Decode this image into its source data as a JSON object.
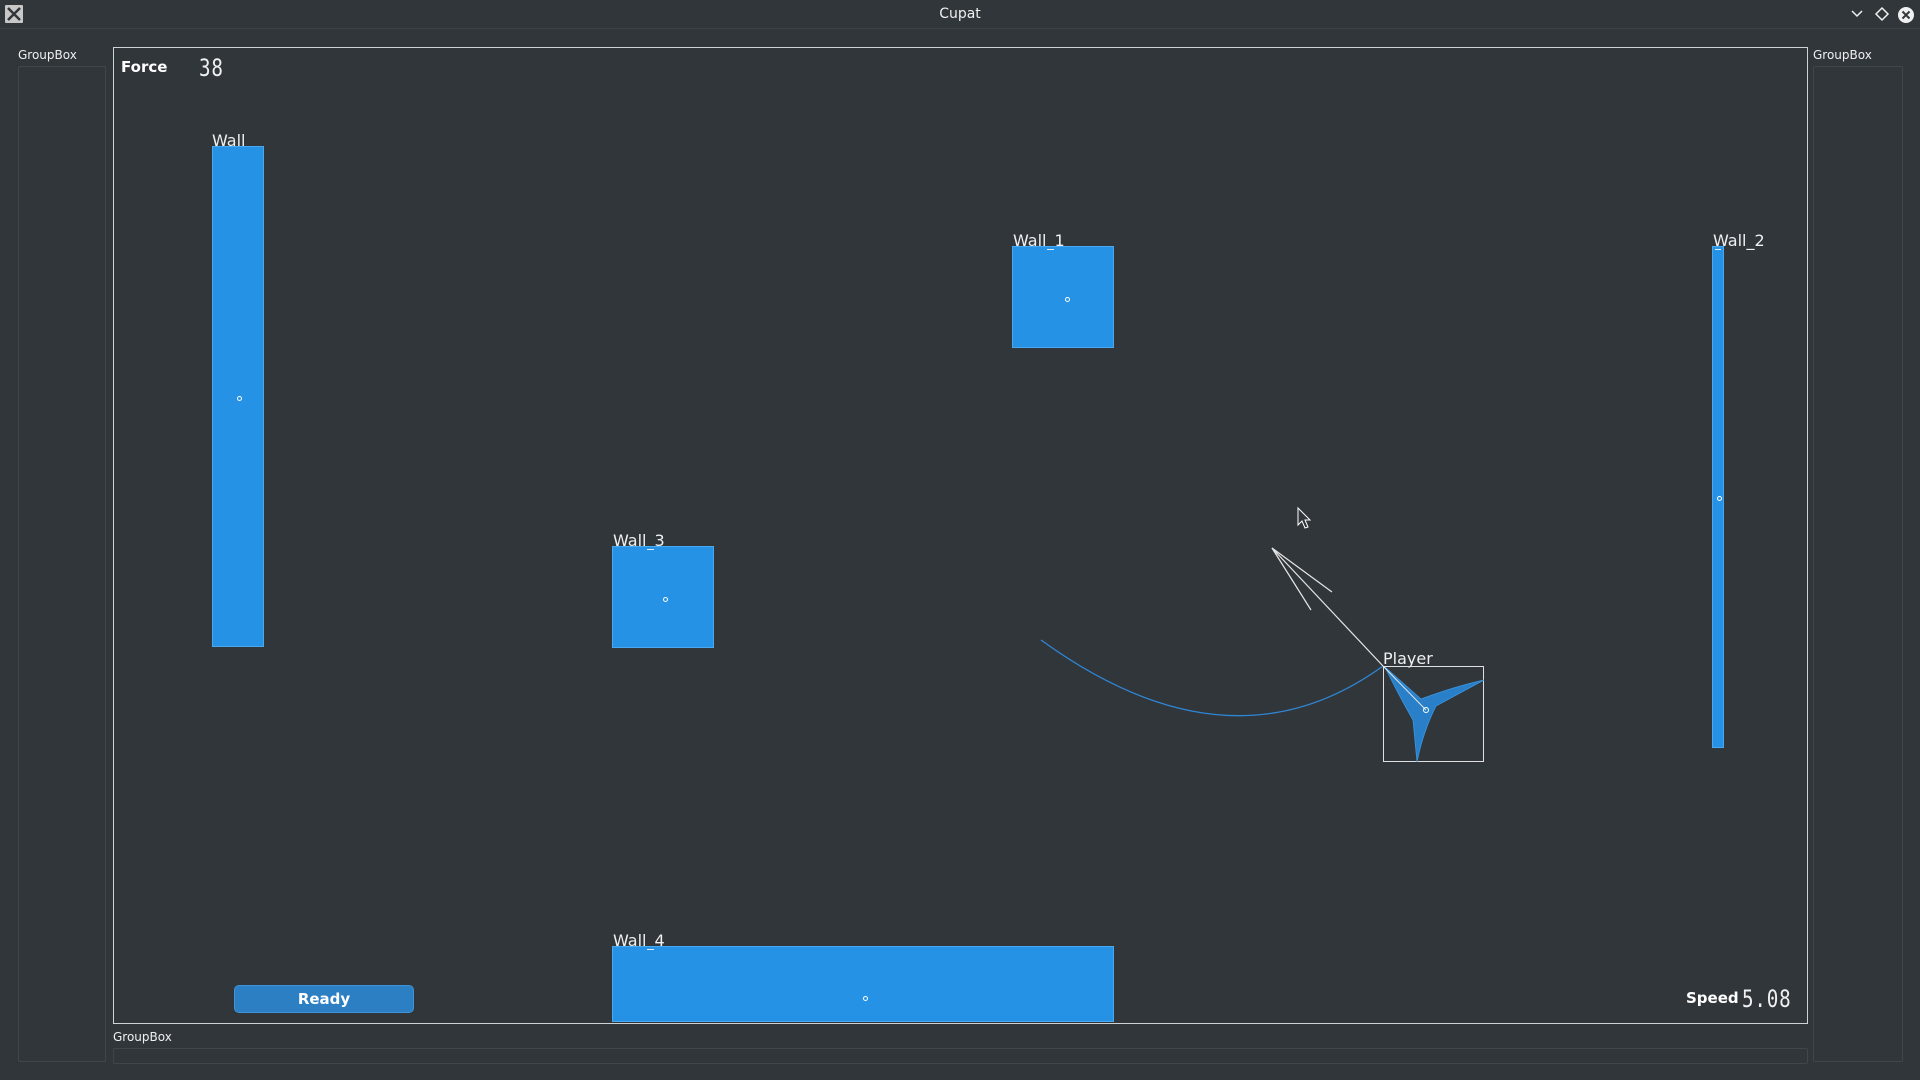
{
  "window": {
    "title": "Cupat"
  },
  "icons": {
    "app": "x-app-icon",
    "minimize": "chevron-down-icon",
    "maximize": "diamond-icon",
    "close": "close-icon",
    "cursor": "mouse-cursor-icon"
  },
  "groupboxes": {
    "left": "GroupBox",
    "right": "GroupBox",
    "bottom": "GroupBox"
  },
  "force": {
    "label": "Force",
    "value": "38"
  },
  "speed": {
    "label": "Speed",
    "value": "5.08"
  },
  "ready_button": {
    "label": "Ready"
  },
  "objects": {
    "wall": "Wall",
    "wall_1": "Wall_1",
    "wall_2": "Wall_2",
    "wall_3": "Wall_3",
    "wall_4": "Wall_4",
    "player": "Player"
  },
  "colors": {
    "background": "#31363b",
    "wall_fill": "#2692e6",
    "player_fill": "#2980c8",
    "button": "#2d7fc3",
    "trajectory": "#2f86d4",
    "text": "#eff0f1"
  }
}
